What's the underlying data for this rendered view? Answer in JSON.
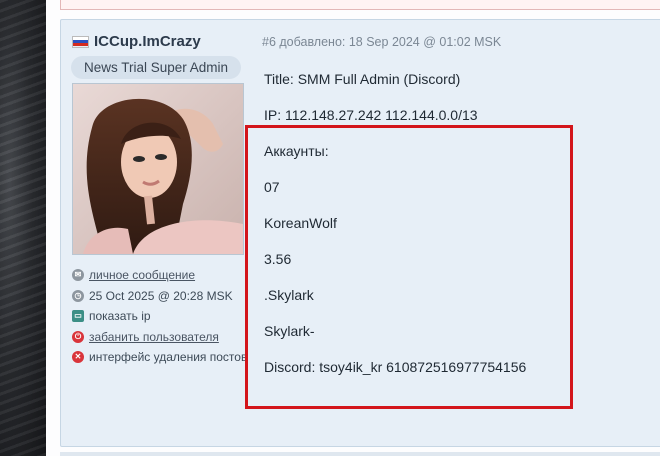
{
  "user": {
    "name": "ICCup.ImCrazy",
    "rank": "News Trial Super Admin",
    "flag_colors": [
      "#ffffff",
      "#2b4fbf",
      "#d52b1e"
    ]
  },
  "post": {
    "meta": "#6 добавлено: 18 Sep 2024 @ 01:02 MSK",
    "lines": [
      "Title: SMM Full Admin (Discord)",
      "IP: 112.148.27.242 112.144.0.0/13",
      "Аккаунты:",
      "07",
      "KoreanWolf",
      "3.56",
      ".Skylark",
      "Skylark-",
      "Discord: tsoy4ik_kr 610872516977754156"
    ]
  },
  "sidebar": {
    "links": [
      {
        "label": "личное сообщение",
        "icon": "mail-icon"
      },
      {
        "label": "25 Oct 2025 @ 20:28 MSK",
        "icon": "clock-icon"
      },
      {
        "label": "показать ip",
        "icon": "monitor-icon"
      },
      {
        "label": "забанить пользователя",
        "icon": "power-icon"
      },
      {
        "label": "интерфейс удаления постов",
        "icon": "delete-icon"
      }
    ]
  },
  "colors": {
    "highlight": "#d3151b",
    "panel": "#e7eff7"
  }
}
